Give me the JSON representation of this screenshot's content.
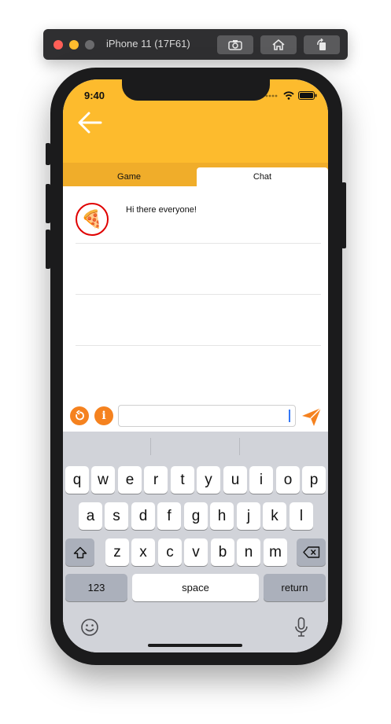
{
  "simulator": {
    "title": "iPhone 11 (17F61)",
    "buttons": [
      "screenshot-icon",
      "home-icon",
      "rotate-icon"
    ]
  },
  "status_bar": {
    "time": "9:40"
  },
  "header": {
    "back_icon": "back-arrow-icon",
    "color": "#fdbb2d"
  },
  "tabs": [
    {
      "label": "Game",
      "selected": false
    },
    {
      "label": "Chat",
      "selected": true
    }
  ],
  "messages": [
    {
      "avatar": "pizza-emoji",
      "avatar_glyph": "🍕",
      "text": "Hi there everyone!"
    }
  ],
  "input_bar": {
    "refresh_icon": "refresh-icon",
    "info_icon": "info-icon",
    "info_glyph": "i",
    "message_value": "",
    "send_icon": "send-icon",
    "accent": "#f5821f"
  },
  "keyboard": {
    "row1": [
      "q",
      "w",
      "e",
      "r",
      "t",
      "y",
      "u",
      "i",
      "o",
      "p"
    ],
    "row2": [
      "a",
      "s",
      "d",
      "f",
      "g",
      "h",
      "j",
      "k",
      "l"
    ],
    "row3": [
      "z",
      "x",
      "c",
      "v",
      "b",
      "n",
      "m"
    ],
    "numbers_label": "123",
    "space_label": "space",
    "return_label": "return",
    "shift_icon": "shift-icon",
    "backspace_icon": "backspace-icon",
    "emoji_icon": "emoji-icon",
    "mic_icon": "microphone-icon"
  }
}
